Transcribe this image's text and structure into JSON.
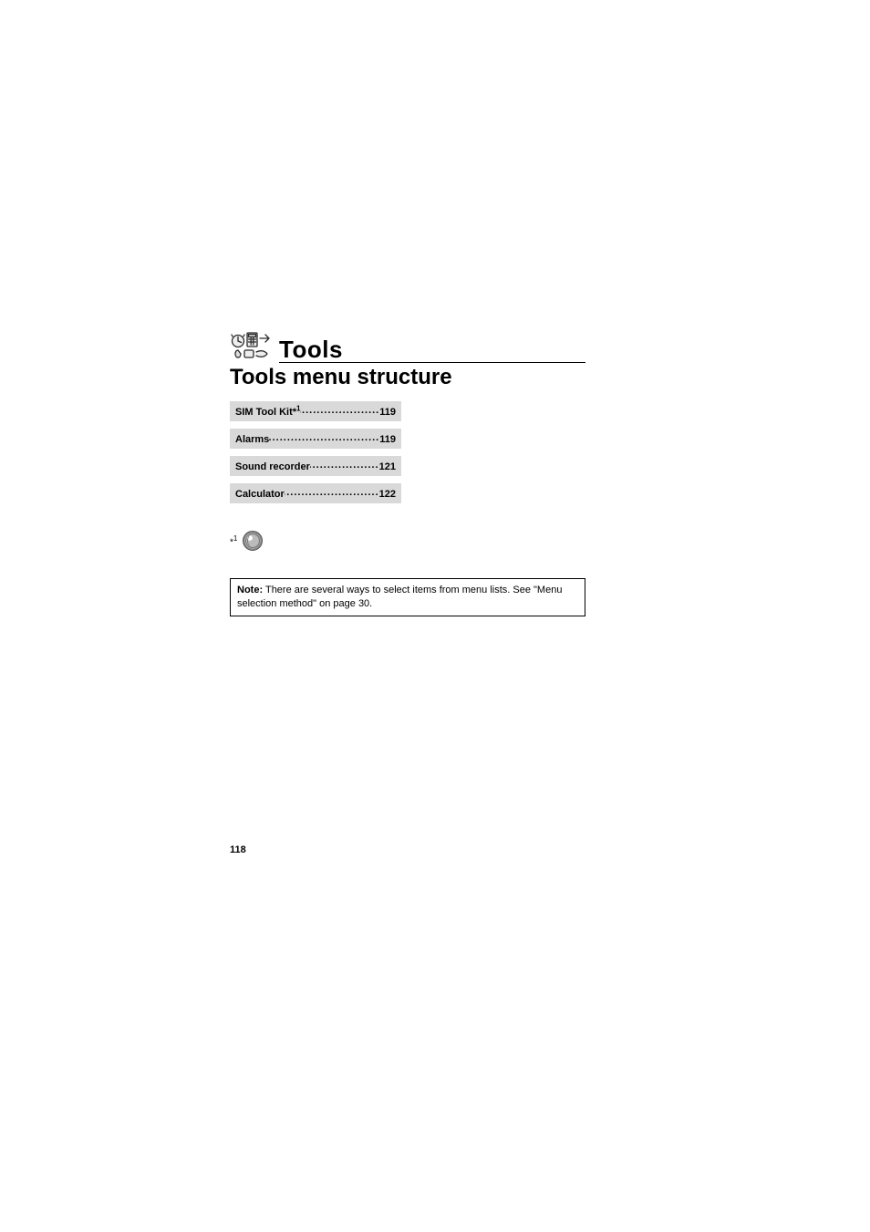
{
  "chapter": {
    "title": "Tools",
    "section": "Tools menu structure"
  },
  "toc": [
    {
      "label_prefix": "SIM Tool Kit*",
      "label_sup": "1",
      "label_suffix": " ",
      "page": "119"
    },
    {
      "label_prefix": "Alarms",
      "label_sup": "",
      "label_suffix": "",
      "page": "119"
    },
    {
      "label_prefix": "Sound recorder",
      "label_sup": "",
      "label_suffix": "",
      "page": "121"
    },
    {
      "label_prefix": "Calculator",
      "label_sup": "",
      "label_suffix": "",
      "page": "122"
    }
  ],
  "footnote": {
    "marker_star": "*",
    "marker_num": "1"
  },
  "note": {
    "label": "Note:",
    "text": "There are several ways to select items from menu lists. See \"Menu selection method\" on page 30."
  },
  "page_number": "118"
}
